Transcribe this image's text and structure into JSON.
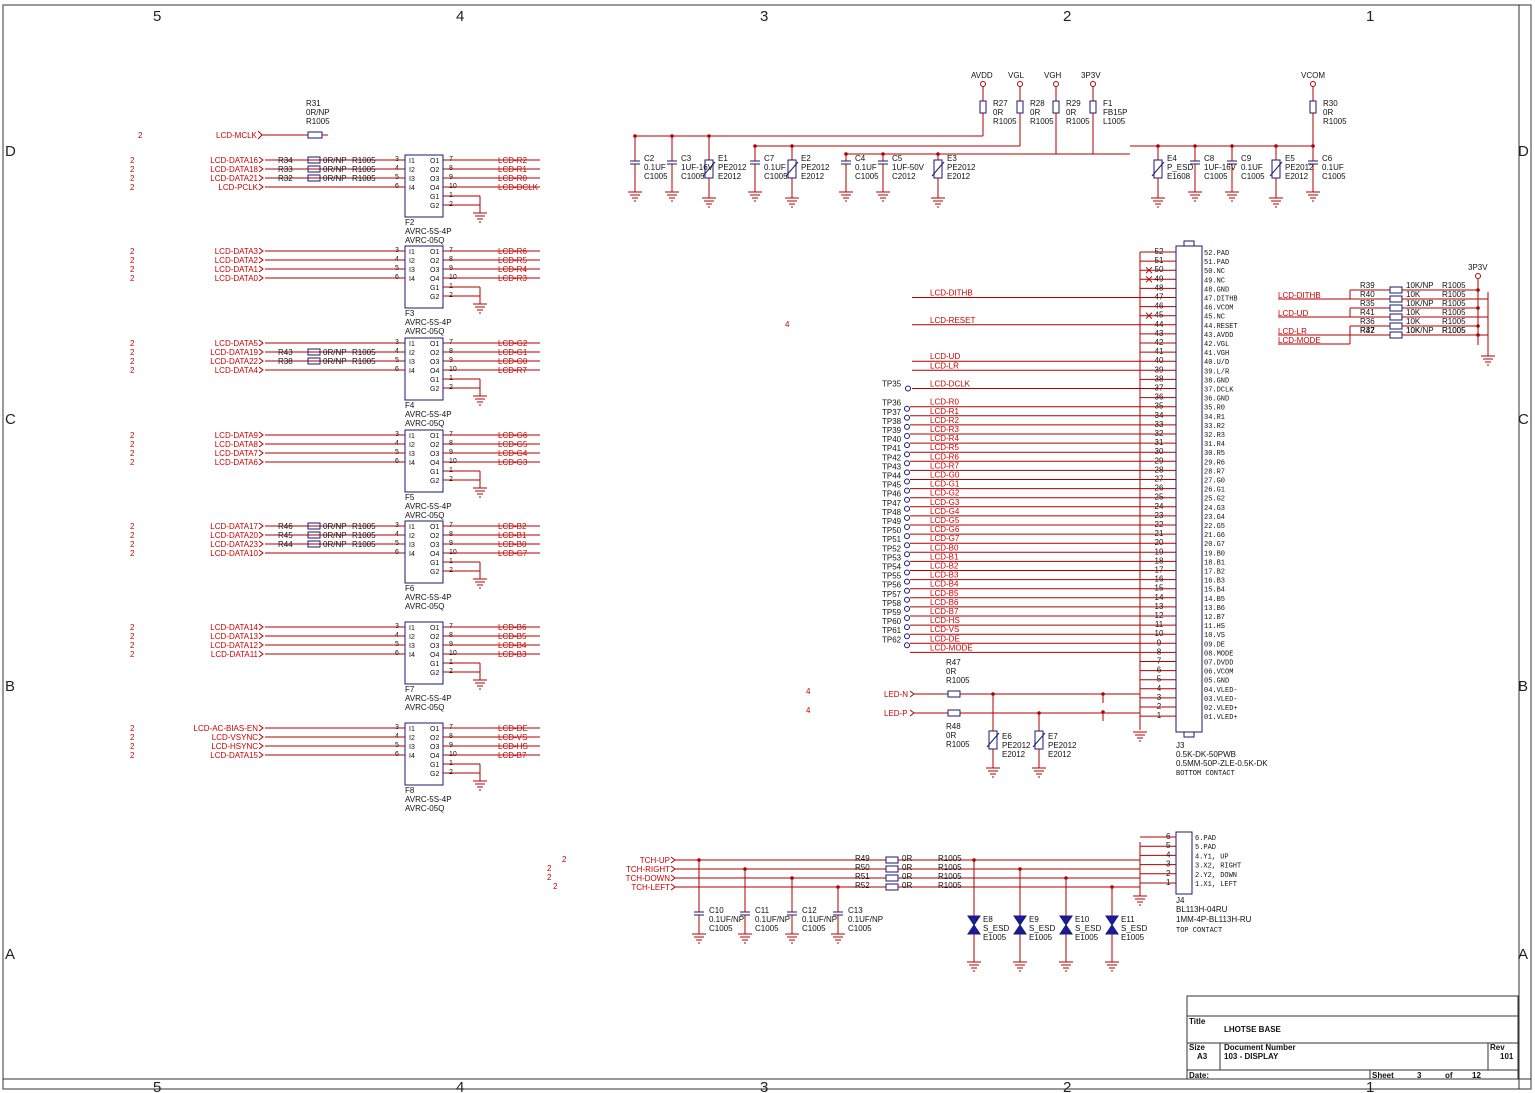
{
  "border": {
    "cols": [
      "5",
      "4",
      "3",
      "2",
      "1"
    ],
    "rows": [
      "D",
      "C",
      "B",
      "A"
    ]
  },
  "mclk": {
    "sheet": "2",
    "net": "LCD-MCLK",
    "ref": "R31",
    "val": "0R/NP",
    "pkg": "R1005"
  },
  "buffers": [
    {
      "ref": "F2",
      "part": "AVRC-5S-4P",
      "pkg": "AVRC-05Q",
      "inputs": [
        {
          "sheet": "2",
          "net": "LCD-DATA16",
          "r": "R34",
          "rv": "0R/NP",
          "rp": "R1005"
        },
        {
          "sheet": "2",
          "net": "LCD-DATA18",
          "r": "R33",
          "rv": "0R/NP",
          "rp": "R1005"
        },
        {
          "sheet": "2",
          "net": "LCD-DATA21",
          "r": "R32",
          "rv": "0R/NP",
          "rp": "R1005"
        },
        {
          "sheet": "2",
          "net": "LCD-PCLK",
          "r": "",
          "rv": "",
          "rp": ""
        }
      ],
      "outputs": [
        "LCD-R2",
        "LCD-R1",
        "LCD-R0",
        "LCD-DCLK"
      ]
    },
    {
      "ref": "F3",
      "part": "AVRC-5S-4P",
      "pkg": "AVRC-05Q",
      "inputs": [
        {
          "sheet": "2",
          "net": "LCD-DATA3",
          "r": "",
          "rv": "",
          "rp": ""
        },
        {
          "sheet": "2",
          "net": "LCD-DATA2",
          "r": "",
          "rv": "",
          "rp": ""
        },
        {
          "sheet": "2",
          "net": "LCD-DATA1",
          "r": "",
          "rv": "",
          "rp": ""
        },
        {
          "sheet": "2",
          "net": "LCD-DATA0",
          "r": "",
          "rv": "",
          "rp": ""
        }
      ],
      "outputs": [
        "LCD-R6",
        "LCD-R5",
        "LCD-R4",
        "LCD-R3"
      ]
    },
    {
      "ref": "F4",
      "part": "AVRC-5S-4P",
      "pkg": "AVRC-05Q",
      "inputs": [
        {
          "sheet": "2",
          "net": "LCD-DATA5",
          "r": "",
          "rv": "",
          "rp": ""
        },
        {
          "sheet": "2",
          "net": "LCD-DATA19",
          "r": "R43",
          "rv": "0R/NP",
          "rp": "R1005"
        },
        {
          "sheet": "2",
          "net": "LCD-DATA22",
          "r": "R38",
          "rv": "0R/NP",
          "rp": "R1005"
        },
        {
          "sheet": "2",
          "net": "LCD-DATA4",
          "r": "",
          "rv": "",
          "rp": ""
        }
      ],
      "outputs": [
        "LCD-G2",
        "LCD-G1",
        "LCD-G0",
        "LCD-R7"
      ]
    },
    {
      "ref": "F5",
      "part": "AVRC-5S-4P",
      "pkg": "AVRC-05Q",
      "inputs": [
        {
          "sheet": "2",
          "net": "LCD-DATA9",
          "r": "",
          "rv": "",
          "rp": ""
        },
        {
          "sheet": "2",
          "net": "LCD-DATA8",
          "r": "",
          "rv": "",
          "rp": ""
        },
        {
          "sheet": "2",
          "net": "LCD-DATA7",
          "r": "",
          "rv": "",
          "rp": ""
        },
        {
          "sheet": "2",
          "net": "LCD-DATA6",
          "r": "",
          "rv": "",
          "rp": ""
        }
      ],
      "outputs": [
        "LCD-G6",
        "LCD-G5",
        "LCD-G4",
        "LCD-G3"
      ]
    },
    {
      "ref": "F6",
      "part": "AVRC-5S-4P",
      "pkg": "AVRC-05Q",
      "inputs": [
        {
          "sheet": "2",
          "net": "LCD-DATA17",
          "r": "R46",
          "rv": "0R/NP",
          "rp": "R1005"
        },
        {
          "sheet": "2",
          "net": "LCD-DATA20",
          "r": "R45",
          "rv": "0R/NP",
          "rp": "R1005"
        },
        {
          "sheet": "2",
          "net": "LCD-DATA23",
          "r": "R44",
          "rv": "0R/NP",
          "rp": "R1005"
        },
        {
          "sheet": "2",
          "net": "LCD-DATA10",
          "r": "",
          "rv": "",
          "rp": ""
        }
      ],
      "outputs": [
        "LCD-B2",
        "LCD-B1",
        "LCD-B0",
        "LCD-G7"
      ]
    },
    {
      "ref": "F7",
      "part": "AVRC-5S-4P",
      "pkg": "AVRC-05Q",
      "inputs": [
        {
          "sheet": "2",
          "net": "LCD-DATA14",
          "r": "",
          "rv": "",
          "rp": ""
        },
        {
          "sheet": "2",
          "net": "LCD-DATA13",
          "r": "",
          "rv": "",
          "rp": ""
        },
        {
          "sheet": "2",
          "net": "LCD-DATA12",
          "r": "",
          "rv": "",
          "rp": ""
        },
        {
          "sheet": "2",
          "net": "LCD-DATA11",
          "r": "",
          "rv": "",
          "rp": ""
        }
      ],
      "outputs": [
        "LCD-B6",
        "LCD-B5",
        "LCD-B4",
        "LCD-B3"
      ]
    },
    {
      "ref": "F8",
      "part": "AVRC-5S-4P",
      "pkg": "AVRC-05Q",
      "inputs": [
        {
          "sheet": "2",
          "net": "LCD-AC-BIAS-EN",
          "r": "",
          "rv": "",
          "rp": ""
        },
        {
          "sheet": "2",
          "net": "LCD-VSYNC",
          "r": "",
          "rv": "",
          "rp": ""
        },
        {
          "sheet": "2",
          "net": "LCD-HSYNC",
          "r": "",
          "rv": "",
          "rp": ""
        },
        {
          "sheet": "2",
          "net": "LCD-DATA15",
          "r": "",
          "rv": "",
          "rp": ""
        }
      ],
      "outputs": [
        "LCD-DE",
        "LCD-VS",
        "LCD-HS",
        "LCD-B7"
      ]
    }
  ],
  "buffer_pins": {
    "in_names": [
      "I1",
      "I2",
      "I3",
      "I4"
    ],
    "in_nums": [
      "3",
      "4",
      "5",
      "6"
    ],
    "out_names": [
      "O1",
      "O2",
      "O3",
      "O4",
      "G1",
      "G2"
    ],
    "out_nums": [
      "7",
      "8",
      "9",
      "10",
      "1",
      "2"
    ]
  },
  "rails": [
    "AVDD",
    "VGL",
    "VGH",
    "3P3V",
    "VCOM"
  ],
  "rail_parts": [
    {
      "ref": "R27",
      "val": "0R",
      "pkg": "R1005"
    },
    {
      "ref": "R28",
      "val": "0R",
      "pkg": "R1005"
    },
    {
      "ref": "R29",
      "val": "0R",
      "pkg": "R1005"
    },
    {
      "ref": "F1",
      "val": "FB15P",
      "pkg": "L1005"
    },
    {
      "ref": "R30",
      "val": "0R",
      "pkg": "R1005"
    }
  ],
  "decoupling": [
    {
      "ref": "C2",
      "val": "0.1UF",
      "pkg": "C1005",
      "kind": "cap"
    },
    {
      "ref": "C3",
      "val": "1UF-16V",
      "pkg": "C1005",
      "kind": "cap"
    },
    {
      "ref": "E1",
      "val": "PE2012",
      "pkg": "E2012",
      "kind": "esd"
    },
    {
      "ref": "C7",
      "val": "0.1UF",
      "pkg": "C1005",
      "kind": "cap"
    },
    {
      "ref": "E2",
      "val": "PE2012",
      "pkg": "E2012",
      "kind": "esd"
    },
    {
      "ref": "C4",
      "val": "0.1UF",
      "pkg": "C1005",
      "kind": "cap"
    },
    {
      "ref": "C5",
      "val": "1UF-50V",
      "pkg": "C2012",
      "kind": "cap"
    },
    {
      "ref": "E3",
      "val": "PE2012",
      "pkg": "E2012",
      "kind": "esd"
    },
    {
      "ref": "E4",
      "val": "P_ESD",
      "pkg": "E1608",
      "kind": "esd"
    },
    {
      "ref": "C8",
      "val": "1UF-16V",
      "pkg": "C1005",
      "kind": "cap"
    },
    {
      "ref": "C9",
      "val": "0.1UF",
      "pkg": "C1005",
      "kind": "cap"
    },
    {
      "ref": "E5",
      "val": "PE2012",
      "pkg": "E2012",
      "kind": "esd"
    },
    {
      "ref": "C6",
      "val": "0.1UF",
      "pkg": "C1005",
      "kind": "cap"
    }
  ],
  "j3": {
    "ref": "J3",
    "part": "0.5K-DK-50PWB",
    "pkg": "0.5MM-50P-ZLE-0.5K-DK",
    "note": "BOTTOM CONTACT",
    "pins": [
      "52.PAD",
      "51.PAD",
      "50.NC",
      "49.NC",
      "48.GND",
      "47.DITHB",
      "46.VCOM",
      "45.NC",
      "44.RESET",
      "43.AVDD",
      "42.VGL",
      "41.VGH",
      "40.U/D",
      "39.L/R",
      "38.GND",
      "37.DCLK",
      "36.GND",
      "35.R0",
      "34.R1",
      "33.R2",
      "32.R3",
      "31.R4",
      "30.R5",
      "29.R6",
      "28.R7",
      "27.G0",
      "26.G1",
      "25.G2",
      "24.G3",
      "23.G4",
      "22.G5",
      "21.G6",
      "20.G7",
      "19.B0",
      "18.B1",
      "17.B2",
      "16.B3",
      "15.B4",
      "14.B5",
      "13.B6",
      "12.B7",
      "11.HS",
      "10.VS",
      "09.DE",
      "08.MODE",
      "07.DVDD",
      "06.VCOM",
      "05.GND",
      "04.VLED-",
      "03.VLED-",
      "02.VLED+",
      "01.VLED+"
    ],
    "nums": [
      "52",
      "51",
      "50",
      "49",
      "48",
      "47",
      "46",
      "45",
      "44",
      "43",
      "42",
      "41",
      "40",
      "39",
      "38",
      "37",
      "36",
      "35",
      "34",
      "33",
      "32",
      "31",
      "30",
      "29",
      "28",
      "27",
      "26",
      "25",
      "24",
      "23",
      "22",
      "21",
      "20",
      "19",
      "18",
      "17",
      "16",
      "15",
      "14",
      "13",
      "12",
      "11",
      "10",
      "9",
      "8",
      "7",
      "6",
      "5",
      "4",
      "3",
      "2",
      "1"
    ]
  },
  "j3_nets": [
    {
      "tp": "",
      "net": "LCD-DITHB"
    },
    {
      "tp": "",
      "net": "LCD-RESET",
      "sheet": "4"
    },
    {
      "tp": "",
      "net": "LCD-UD"
    },
    {
      "tp": "",
      "net": "LCD-LR"
    },
    {
      "tp": "TP35",
      "net": "LCD-DCLK"
    }
  ],
  "testpoints": [
    {
      "tp": "TP36",
      "net": "LCD-R0"
    },
    {
      "tp": "TP37",
      "net": "LCD-R1"
    },
    {
      "tp": "TP38",
      "net": "LCD-R2"
    },
    {
      "tp": "TP39",
      "net": "LCD-R3"
    },
    {
      "tp": "TP40",
      "net": "LCD-R4"
    },
    {
      "tp": "TP41",
      "net": "LCD-R5"
    },
    {
      "tp": "TP42",
      "net": "LCD-R6"
    },
    {
      "tp": "TP43",
      "net": "LCD-R7"
    },
    {
      "tp": "TP44",
      "net": "LCD-G0"
    },
    {
      "tp": "TP45",
      "net": "LCD-G1"
    },
    {
      "tp": "TP46",
      "net": "LCD-G2"
    },
    {
      "tp": "TP47",
      "net": "LCD-G3"
    },
    {
      "tp": "TP48",
      "net": "LCD-G4"
    },
    {
      "tp": "TP49",
      "net": "LCD-G5"
    },
    {
      "tp": "TP50",
      "net": "LCD-G6"
    },
    {
      "tp": "TP51",
      "net": "LCD-G7"
    },
    {
      "tp": "TP52",
      "net": "LCD-B0"
    },
    {
      "tp": "TP53",
      "net": "LCD-B1"
    },
    {
      "tp": "TP54",
      "net": "LCD-B2"
    },
    {
      "tp": "TP55",
      "net": "LCD-B3"
    },
    {
      "tp": "TP56",
      "net": "LCD-B4"
    },
    {
      "tp": "TP57",
      "net": "LCD-B5"
    },
    {
      "tp": "TP58",
      "net": "LCD-B6"
    },
    {
      "tp": "TP59",
      "net": "LCD-B7"
    },
    {
      "tp": "TP60",
      "net": "LCD-HS"
    },
    {
      "tp": "TP61",
      "net": "LCD-VS"
    },
    {
      "tp": "TP62",
      "net": "LCD-DE"
    },
    {
      "tp": "",
      "net": "LCD-MODE"
    }
  ],
  "led": {
    "n": {
      "sheet": "4",
      "net": "LED-N"
    },
    "p": {
      "sheet": "4",
      "net": "LED-P"
    },
    "r47": {
      "ref": "R47",
      "val": "0R",
      "pkg": "R1005"
    },
    "r48": {
      "ref": "R48",
      "val": "0R",
      "pkg": "R1005"
    },
    "e6": {
      "ref": "E6",
      "val": "PE2012",
      "pkg": "E2012"
    },
    "e7": {
      "ref": "E7",
      "val": "PE2012",
      "pkg": "E2012"
    }
  },
  "mode_net": {
    "rail": "3P3V",
    "rows": [
      {
        "net": "LCD-DITHB",
        "r1": "R39",
        "v1": "10K/NP",
        "r2": "R40",
        "v2": "10K",
        "pkg": "R1005"
      },
      {
        "net": "LCD-UD",
        "r1": "R35",
        "v1": "10K/NP",
        "r2": "R41",
        "v2": "10K",
        "pkg": "R1005"
      },
      {
        "net": "LCD-LR",
        "r1": "R36",
        "v1": "10K",
        "r2": "R37",
        "v2": "10K/NP",
        "pkg": "R1005"
      },
      {
        "net": "LCD-MODE",
        "r1": "R42",
        "v1": "10K",
        "r2": "",
        "v2": "",
        "pkg": "R1005"
      }
    ]
  },
  "touch": {
    "sheet": "2",
    "nets": [
      "TCH-UP",
      "TCH-RIGHT",
      "TCH-DOWN",
      "TCH-LEFT"
    ],
    "res": [
      {
        "ref": "R49",
        "val": "0R",
        "pkg": "R1005"
      },
      {
        "ref": "R50",
        "val": "0R",
        "pkg": "R1005"
      },
      {
        "ref": "R51",
        "val": "0R",
        "pkg": "R1005"
      },
      {
        "ref": "R52",
        "val": "0R",
        "pkg": "R1005"
      }
    ],
    "caps": [
      {
        "ref": "C10",
        "val": "0.1UF/NP",
        "pkg": "C1005"
      },
      {
        "ref": "C11",
        "val": "0.1UF/NP",
        "pkg": "C1005"
      },
      {
        "ref": "C12",
        "val": "0.1UF/NP",
        "pkg": "C1005"
      },
      {
        "ref": "C13",
        "val": "0.1UF/NP",
        "pkg": "C1005"
      }
    ],
    "esd": [
      {
        "ref": "E8",
        "val": "S_ESD",
        "pkg": "E1005"
      },
      {
        "ref": "E9",
        "val": "S_ESD",
        "pkg": "E1005"
      },
      {
        "ref": "E10",
        "val": "S_ESD",
        "pkg": "E1005"
      },
      {
        "ref": "E11",
        "val": "S_ESD",
        "pkg": "E1005"
      }
    ],
    "j4": {
      "ref": "J4",
      "part": "BL113H-04RU",
      "pkg": "1MM-4P-BL113H-RU",
      "note": "TOP CONTACT",
      "pins": [
        "6.PAD",
        "5.PAD",
        "4.Y1, UP",
        "3.X2, RIGHT",
        "2.Y2, DOWN",
        "1.X1, LEFT"
      ],
      "nums": [
        "6",
        "5",
        "4",
        "3",
        "2",
        "1"
      ]
    }
  },
  "titleblock": {
    "title_label": "Title",
    "title": "LHOTSE BASE",
    "size_label": "Size",
    "size": "A3",
    "docnum_label": "Document Number",
    "docnum": "103 - DISPLAY",
    "rev_label": "Rev",
    "rev": "101",
    "date_label": "Date:",
    "sheet_label": "Sheet",
    "sheet": "3",
    "of_label": "of",
    "total": "12"
  },
  "colors": {
    "net": "#cc0000",
    "wire": "#b00000",
    "part": "#1a1a6e",
    "text": "#111111",
    "tp": "#1a1a6e"
  }
}
